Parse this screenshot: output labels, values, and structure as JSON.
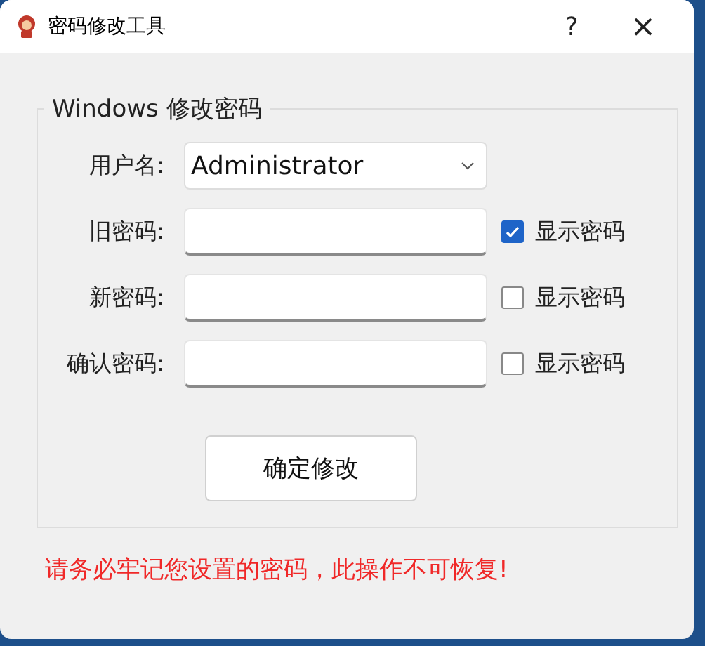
{
  "window": {
    "title": "密码修改工具",
    "help_button": "?",
    "close_button": "×"
  },
  "group": {
    "title": "Windows 修改密码",
    "rows": [
      {
        "kind": "combo",
        "label": "用户名:",
        "value": "Administrator"
      },
      {
        "kind": "password",
        "label": "旧密码:",
        "toggle": {
          "label": "显示密码",
          "checked": true
        }
      },
      {
        "kind": "password",
        "label": "新密码:",
        "toggle": {
          "label": "显示密码",
          "checked": false
        }
      },
      {
        "kind": "password",
        "label": "确认密码:",
        "toggle": {
          "label": "显示密码",
          "checked": false
        }
      }
    ],
    "submit": "确定修改"
  },
  "warning": "请务必牢记您设置的密码，此操作不可恢复!"
}
